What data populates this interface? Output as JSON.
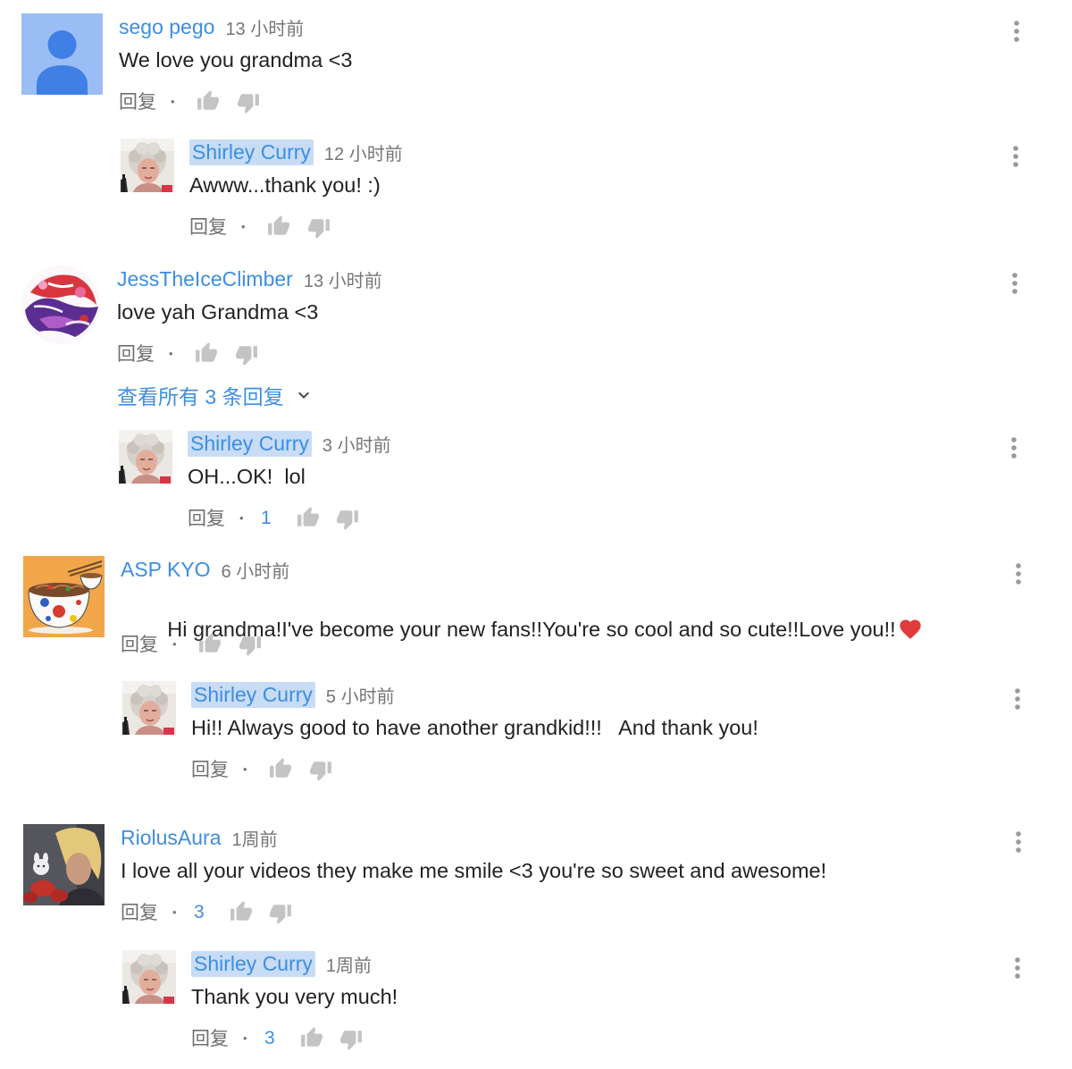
{
  "colors": {
    "link": "#3d8ee2",
    "owner_highlight": "#c8dcf6",
    "text": "#222222",
    "meta": "#767676",
    "icon": "#c4c4c4"
  },
  "labels": {
    "reply": "回复",
    "separator": "•"
  },
  "comments": [
    {
      "avatar": "default-user-avatar",
      "author": "sego pego",
      "time": "13 小时前",
      "text": "We love you grandma <3",
      "replies": [
        {
          "avatar": "shirley-curry-avatar",
          "author": "Shirley Curry",
          "author_highlighted": true,
          "time": "12 小时前",
          "text": "Awww...thank you! :)"
        }
      ]
    },
    {
      "avatar": "abstract-purple-red-avatar",
      "author": "JessTheIceClimber",
      "time": "13 小时前",
      "text": "love yah Grandma <3",
      "view_all_replies": "查看所有 3 条回复",
      "replies": [
        {
          "avatar": "shirley-curry-avatar",
          "author": "Shirley Curry",
          "author_highlighted": true,
          "time": "3 小时前",
          "text": "OH...OK!  lol",
          "like_count": "1"
        }
      ]
    },
    {
      "avatar": "noodle-bowl-avatar",
      "author": "ASP KYO",
      "time": "6 小时前",
      "text": "Hi grandma!I've become your new fans!!You're so cool and so cute!!Love you!!",
      "trailing_emoji": "red-heart-emoji",
      "replies": [
        {
          "avatar": "shirley-curry-avatar",
          "author": "Shirley Curry",
          "author_highlighted": true,
          "time": "5 小时前",
          "text": "Hi!! Always good to have another grandkid!!!   And thank you!"
        }
      ]
    },
    {
      "avatar": "blonde-figure-photo-avatar",
      "author": "RiolusAura",
      "time": "1周前",
      "text": "I love all your videos they make me smile <3 you're so sweet and awesome!",
      "like_count": "3",
      "replies": [
        {
          "avatar": "shirley-curry-avatar",
          "author": "Shirley Curry",
          "author_highlighted": true,
          "time": "1周前",
          "text": "Thank you very much!",
          "like_count": "3"
        }
      ]
    }
  ]
}
